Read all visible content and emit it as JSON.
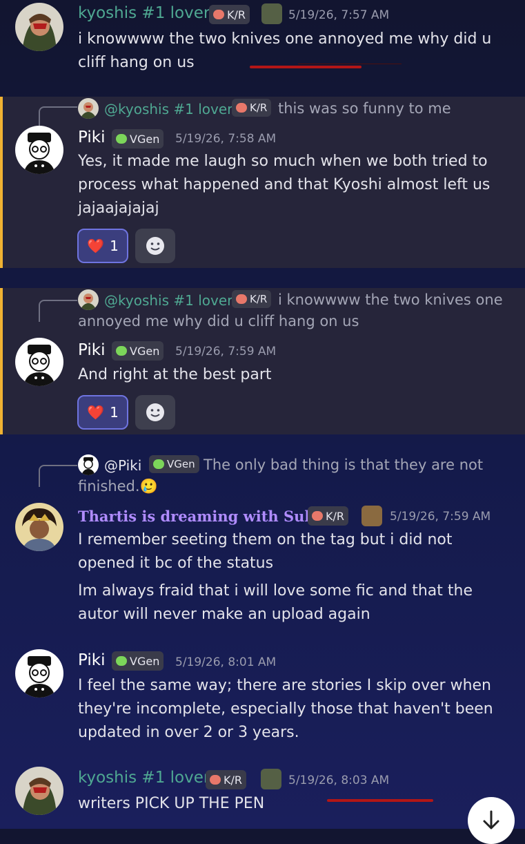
{
  "messages": [
    {
      "author": "kyoshis #1 lover",
      "badge": "K/R",
      "time": "5/19/26, 7:57 AM",
      "text": "i knowwww the two knives one annoyed me why did u cliff hang on us"
    },
    {
      "reply_to": {
        "author": "@kyoshis #1 lover",
        "badge": "K/R",
        "text": "this was so funny to me"
      },
      "author": "Piki",
      "badge": "VGen",
      "time": "5/19/26, 7:58 AM",
      "text": "Yes, it made me laugh so much when we both tried to process what happened and that Kyoshi almost left us jajaajajajaj",
      "reaction": {
        "emoji": "❤️",
        "count": "1"
      }
    },
    {
      "reply_to": {
        "author": "@kyoshis #1 lover",
        "badge": "K/R",
        "text": "i knowwww the two knives one annoyed me why did u cliff hang on us"
      },
      "author": "Piki",
      "badge": "VGen",
      "time": "5/19/26, 7:59 AM",
      "text": "And right at the best part",
      "reaction": {
        "emoji": "❤️",
        "count": "1"
      }
    },
    {
      "reply_to": {
        "author": "@Piki",
        "badge": "VGen",
        "text": "The only bad thing is that they are not finished.🥲"
      },
      "author": "Thartis is dreaming with Suki",
      "badge": "K/R",
      "time": "5/19/26, 7:59 AM",
      "text": "I remember seeting them on the tag but i did not opened it bc of the status",
      "text2": "Im always fraid that i will love some fic and that the autor will never make an upload again"
    },
    {
      "author": "Piki",
      "badge": "VGen",
      "time": "5/19/26, 8:01 AM",
      "text": "I feel the same way; there are stories I skip over when they're incomplete, especially those that haven't been updated in over 2 or 3 years."
    },
    {
      "author": "kyoshis #1 lover",
      "badge": "K/R",
      "time": "5/19/26, 8:03 AM",
      "text": "writers PICK UP THE PEN"
    }
  ],
  "icons": {
    "add_reaction": "smiley-plus-icon",
    "scroll_down": "arrow-down-icon"
  },
  "colors": {
    "highlight_bar": "#f0b232",
    "username_kyoshi": "#4fa892",
    "username_thartis": "#b08cff",
    "annotation": "#b31616"
  }
}
